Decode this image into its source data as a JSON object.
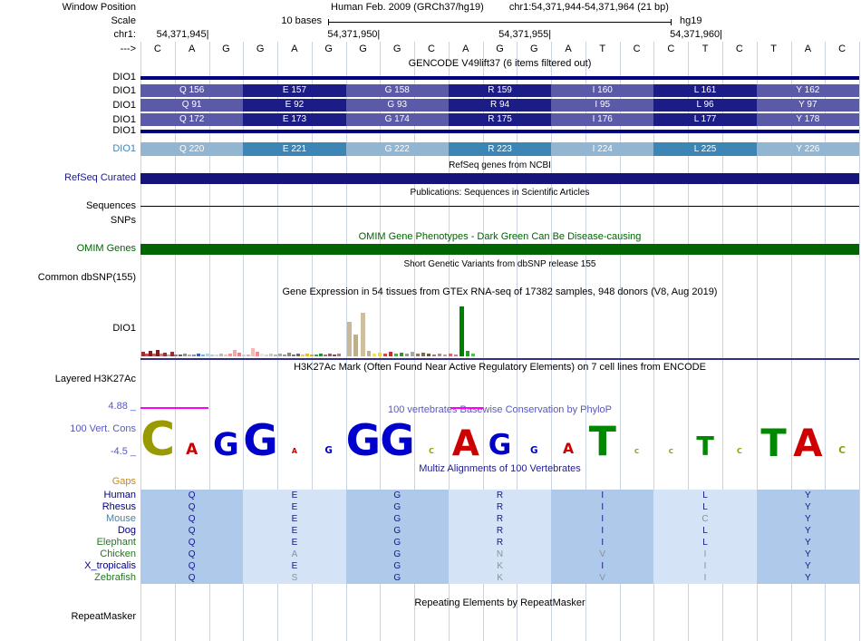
{
  "colors": {
    "navy": "#000080",
    "grid": "#ccd4e4",
    "gencode_dark_a": "#5a5aa8",
    "gencode_dark_b": "#1c1c86",
    "gencode_light_a": "#92b5d2",
    "gencode_light_b": "#3d85b5",
    "refseq_bar": "#14147a",
    "omim_bar": "#006400",
    "mz_dark": "#aec9ea",
    "mz_light": "#d4e3f6",
    "gtex_axis": "#30308a",
    "clip": "#ff00ff",
    "cons_text": "#5858c0",
    "multiz_text": "#202090",
    "gaps_text": "#c88820",
    "logo_A": "#cc0000",
    "logo_C": "#999900",
    "logo_G": "#0000cc",
    "logo_T": "#008800"
  },
  "header": {
    "window_position_label": "Window Position",
    "assembly": "Human Feb. 2009 (GRCh37/hg19)",
    "position": "chr1:54,371,944-54,371,964 (21 bp)",
    "scale_label": "Scale",
    "scale_value": "10 bases",
    "genome": "hg19",
    "chrom_label": "chr1:",
    "strand_label": "--->",
    "ticks": [
      {
        "text": "54,371,945",
        "base_end": 2
      },
      {
        "text": "54,371,950",
        "base_end": 7
      },
      {
        "text": "54,371,955",
        "base_end": 12
      },
      {
        "text": "54,371,960",
        "base_end": 17
      }
    ]
  },
  "sequence": {
    "bases": [
      "C",
      "A",
      "G",
      "G",
      "A",
      "G",
      "G",
      "G",
      "C",
      "A",
      "G",
      "G",
      "A",
      "T",
      "C",
      "C",
      "T",
      "C",
      "T",
      "A",
      "C"
    ]
  },
  "tracks": {
    "gencode": {
      "title": "GENCODE V49lift37 (6 items filtered out)",
      "rows": [
        {
          "label": "DIO1",
          "type": "thin"
        },
        {
          "label": "DIO1",
          "type": "aa",
          "shade": "dark",
          "cells": [
            "Q 156",
            "E 157",
            "G 158",
            "R 159",
            "I 160",
            "L 161",
            "Y 162"
          ]
        },
        {
          "label": "DIO1",
          "type": "aa",
          "shade": "dark",
          "cells": [
            "Q 91",
            "E 92",
            "G 93",
            "R 94",
            "I 95",
            "L 96",
            "Y 97"
          ]
        },
        {
          "label": "DIO1",
          "type": "aa",
          "shade": "dark",
          "cells": [
            "Q 172",
            "E 173",
            "G 174",
            "R 175",
            "I 176",
            "L 177",
            "Y 178"
          ]
        },
        {
          "label": "DIO1",
          "type": "thin"
        },
        {
          "label": "DIO1",
          "type": "aa",
          "shade": "light",
          "label_color": "#3d85b5",
          "cells": [
            "Q 220",
            "E 221",
            "G 222",
            "R 223",
            "I 224",
            "L 225",
            "Y 226"
          ]
        }
      ]
    },
    "refseq": {
      "title": "RefSeq genes from NCBI",
      "label": "RefSeq Curated"
    },
    "publications": {
      "title": "Publications: Sequences in Scientific Articles",
      "label": "Sequences"
    },
    "snps": {
      "label": "SNPs"
    },
    "omim": {
      "title": "OMIM Gene Phenotypes - Dark Green Can Be Disease-causing",
      "label": "OMIM Genes"
    },
    "dbsnp": {
      "title": "Short Genetic Variants from dbSNP release 155",
      "label": "Common dbSNP(155)"
    },
    "gtex": {
      "title": "Gene Expression in 54 tissues from GTEx RNA-seq of 17382 samples, 948 donors (V8, Aug 2019)",
      "label": "DIO1",
      "bars": [
        [
          1,
          5,
          "#a03030"
        ],
        [
          5,
          3,
          "#c05050"
        ],
        [
          9,
          6,
          "#8b1a1a"
        ],
        [
          13,
          3,
          "#c06060"
        ],
        [
          17,
          7,
          "#7a1f1f"
        ],
        [
          21,
          3,
          "#d08080"
        ],
        [
          25,
          4,
          "#a03030"
        ],
        [
          29,
          2,
          "#c0a0a0"
        ],
        [
          33,
          5,
          "#903030"
        ],
        [
          37,
          2,
          "#b86868"
        ],
        [
          42,
          2,
          "#606060"
        ],
        [
          47,
          3,
          "#909090"
        ],
        [
          52,
          2,
          "#b0b0b0"
        ],
        [
          57,
          2,
          "#8090c0"
        ],
        [
          62,
          3,
          "#4060c0"
        ],
        [
          67,
          2,
          "#70b8e8"
        ],
        [
          72,
          3,
          "#a8d8f0"
        ],
        [
          77,
          2,
          "#c8c8c8"
        ],
        [
          82,
          2,
          "#d8d8d8"
        ],
        [
          87,
          3,
          "#b8b8b8"
        ],
        [
          92,
          2,
          "#f0c0c0"
        ],
        [
          97,
          3,
          "#f09898"
        ],
        [
          102,
          7,
          "#f0a8a8"
        ],
        [
          107,
          4,
          "#e08888"
        ],
        [
          112,
          2,
          "#d0d0d0"
        ],
        [
          117,
          2,
          "#c0c0c0"
        ],
        [
          122,
          9,
          "#f8b8b8"
        ],
        [
          127,
          5,
          "#f09090"
        ],
        [
          132,
          3,
          "#e8e8e8"
        ],
        [
          137,
          2,
          "#d8d8d8"
        ],
        [
          142,
          3,
          "#c8c8c8"
        ],
        [
          147,
          2,
          "#b8b8b8"
        ],
        [
          152,
          3,
          "#a8a8a8"
        ],
        [
          157,
          2,
          "#989898"
        ],
        [
          162,
          4,
          "#888888"
        ],
        [
          167,
          2,
          "#787878"
        ],
        [
          172,
          3,
          "#686868"
        ],
        [
          177,
          2,
          "#f0d040"
        ],
        [
          182,
          3,
          "#e0c030"
        ],
        [
          187,
          2,
          "#d0b020"
        ],
        [
          192,
          2,
          "#40a040"
        ],
        [
          197,
          3,
          "#308830"
        ],
        [
          202,
          2,
          "#b07070"
        ],
        [
          207,
          3,
          "#906060"
        ],
        [
          212,
          2,
          "#805050"
        ],
        [
          217,
          3,
          "#a08080"
        ],
        [
          228,
          38,
          "#c9b998",
          5
        ],
        [
          235,
          24,
          "#bfae8a",
          5
        ],
        [
          243,
          48,
          "#cfbf9e",
          5
        ],
        [
          250,
          6,
          "#c0b090"
        ],
        [
          256,
          3,
          "#f0e060"
        ],
        [
          262,
          4,
          "#e8d850"
        ],
        [
          268,
          3,
          "#e04040"
        ],
        [
          274,
          5,
          "#c03030"
        ],
        [
          280,
          3,
          "#50a850"
        ],
        [
          286,
          4,
          "#389038"
        ],
        [
          292,
          3,
          "#989898"
        ],
        [
          298,
          5,
          "#a8a8a8"
        ],
        [
          304,
          3,
          "#907860"
        ],
        [
          310,
          4,
          "#806850"
        ],
        [
          316,
          3,
          "#705840"
        ],
        [
          322,
          2,
          "#a07890"
        ],
        [
          328,
          3,
          "#b088a0"
        ],
        [
          334,
          2,
          "#c098b0"
        ],
        [
          340,
          3,
          "#d06878"
        ],
        [
          346,
          2,
          "#e07888"
        ],
        [
          352,
          55,
          "#008000",
          5
        ],
        [
          359,
          6,
          "#20a020"
        ],
        [
          365,
          3,
          "#50c050"
        ]
      ]
    },
    "h3k27ac": {
      "title": "H3K27Ac Mark (Often Found Near Active Regulatory Elements) on 7 cell lines from ENCODE",
      "label": "Layered H3K27Ac"
    },
    "conservation": {
      "title": "100 vertebrates Basewise Conservation by PhyloP",
      "label": "100 Vert. Cons",
      "max_label": "4.88 _",
      "min_label": "-4.5 _",
      "clips": [
        [
          0,
          75
        ],
        [
          342,
          378
        ]
      ],
      "logo": [
        {
          "b": "C",
          "h": 40
        },
        {
          "b": "A",
          "h": 13
        },
        {
          "b": "G",
          "h": 27
        },
        {
          "b": "G",
          "h": 36
        },
        {
          "b": "A",
          "h": 6
        },
        {
          "b": "G",
          "h": 8
        },
        {
          "b": "G",
          "h": 36
        },
        {
          "b": "G",
          "h": 36
        },
        {
          "b": "C",
          "h": 6
        },
        {
          "b": "A",
          "h": 30
        },
        {
          "b": "G",
          "h": 24
        },
        {
          "b": "G",
          "h": 8
        },
        {
          "b": "A",
          "h": 12
        },
        {
          "b": "T",
          "h": 34
        },
        {
          "b": "C",
          "h": 5
        },
        {
          "b": "C",
          "h": 5
        },
        {
          "b": "T",
          "h": 22
        },
        {
          "b": "C",
          "h": 6
        },
        {
          "b": "T",
          "h": 32
        },
        {
          "b": "A",
          "h": 32
        },
        {
          "b": "C",
          "h": 8
        }
      ]
    },
    "multiz": {
      "title": "Multiz Alignments of 100 Vertebrates",
      "gaps_label": "Gaps",
      "species": [
        {
          "name": "Human",
          "color": "#000080",
          "aa": [
            "Q",
            "E",
            "G",
            "R",
            "I",
            "L",
            "Y"
          ],
          "gray": [
            false,
            false,
            false,
            false,
            false,
            false,
            false
          ]
        },
        {
          "name": "Rhesus",
          "color": "#000080",
          "aa": [
            "Q",
            "E",
            "G",
            "R",
            "I",
            "L",
            "Y"
          ],
          "gray": [
            false,
            false,
            false,
            false,
            false,
            false,
            false
          ]
        },
        {
          "name": "Mouse",
          "color": "#4f7fa0",
          "aa": [
            "Q",
            "E",
            "G",
            "R",
            "I",
            "C",
            "Y"
          ],
          "gray": [
            false,
            false,
            false,
            false,
            false,
            true,
            false
          ]
        },
        {
          "name": "Dog",
          "color": "#000080",
          "aa": [
            "Q",
            "E",
            "G",
            "R",
            "I",
            "L",
            "Y"
          ],
          "gray": [
            false,
            false,
            false,
            false,
            false,
            false,
            false
          ]
        },
        {
          "name": "Elephant",
          "color": "#1f7a1f",
          "aa": [
            "Q",
            "E",
            "G",
            "R",
            "I",
            "L",
            "Y"
          ],
          "gray": [
            false,
            false,
            false,
            false,
            false,
            false,
            false
          ]
        },
        {
          "name": "Chicken",
          "color": "#1f7a1f",
          "aa": [
            "Q",
            "A",
            "G",
            "N",
            "V",
            "I",
            "Y"
          ],
          "gray": [
            false,
            true,
            false,
            true,
            true,
            true,
            false
          ]
        },
        {
          "name": "X_tropicalis",
          "color": "#000080",
          "aa": [
            "Q",
            "E",
            "G",
            "K",
            "I",
            "I",
            "Y"
          ],
          "gray": [
            false,
            false,
            false,
            true,
            false,
            true,
            false
          ]
        },
        {
          "name": "Zebrafish",
          "color": "#1f7a1f",
          "aa": [
            "Q",
            "S",
            "G",
            "K",
            "V",
            "I",
            "Y"
          ],
          "gray": [
            false,
            true,
            false,
            true,
            true,
            true,
            false
          ]
        }
      ]
    },
    "repeatmasker": {
      "title": "Repeating Elements by RepeatMasker",
      "label": "RepeatMasker"
    }
  }
}
